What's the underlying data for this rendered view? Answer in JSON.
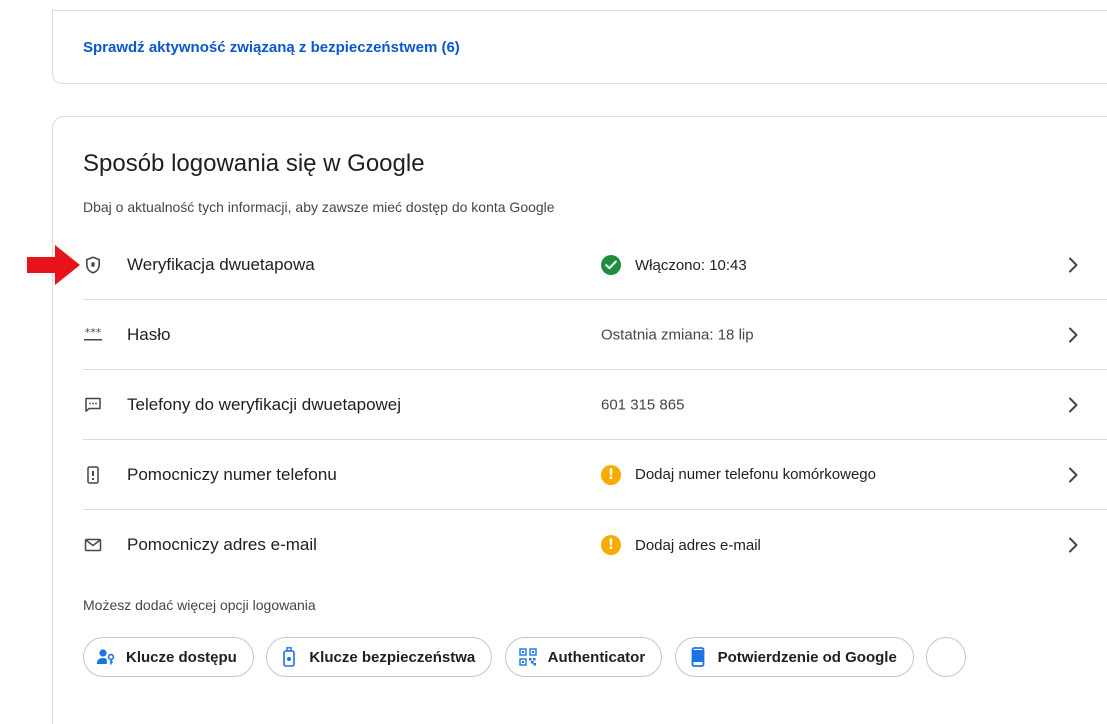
{
  "security_activity": {
    "link_label": "Sprawdź aktywność związaną z bezpieczeństwem (6)"
  },
  "signin": {
    "title": "Sposób logowania się w Google",
    "subtitle": "Dbaj o aktualność tych informacji, aby zawsze mieć dostęp do konta Google",
    "rows": [
      {
        "icon": "shield-icon",
        "label": "Weryfikacja dwuetapowa",
        "value": "Włączono: 10:43",
        "status": "ok"
      },
      {
        "icon": "password-dots-icon",
        "label": "Hasło",
        "value": "Ostatnia zmiana: 18 lip",
        "status": "none"
      },
      {
        "icon": "message-icon",
        "label": "Telefony do weryfikacji dwuetapowej",
        "value": "601 315 865",
        "status": "none"
      },
      {
        "icon": "phone-icon",
        "label": "Pomocniczy numer telefonu",
        "value": "Dodaj numer telefonu komórkowego",
        "status": "warn"
      },
      {
        "icon": "mail-icon",
        "label": "Pomocniczy adres e-mail",
        "value": "Dodaj adres e-mail",
        "status": "warn"
      }
    ],
    "more_options_label": "Możesz dodać więcej opcji logowania",
    "chips": [
      {
        "icon": "passkey-icon",
        "label": "Klucze dostępu"
      },
      {
        "icon": "security-key-icon",
        "label": "Klucze bezpieczeństwa"
      },
      {
        "icon": "authenticator-icon",
        "label": "Authenticator"
      },
      {
        "icon": "phone-prompt-icon",
        "label": "Potwierdzenie od Google"
      }
    ]
  },
  "colors": {
    "link": "#0b57d0",
    "ok": "#1e8e3e",
    "warn": "#f9ab00",
    "accent_icon": "#1a73e8",
    "annotation_arrow": "#e8121b"
  }
}
